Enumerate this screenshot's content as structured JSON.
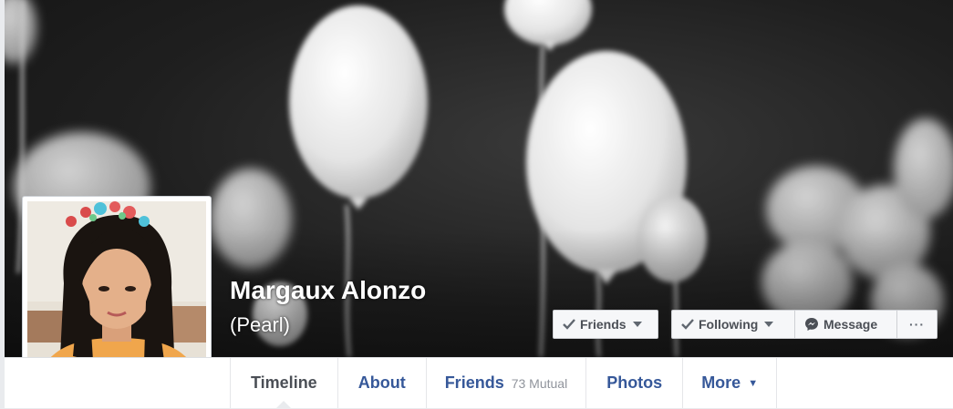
{
  "profile": {
    "name": "Margaux Alonzo",
    "alternate_name": "(Pearl)"
  },
  "actions": {
    "friends_label": "Friends",
    "following_label": "Following",
    "message_label": "Message",
    "more_label": "···"
  },
  "tabs": [
    {
      "label": "Timeline",
      "active": true
    },
    {
      "label": "About"
    },
    {
      "label": "Friends",
      "count": "73 Mutual"
    },
    {
      "label": "Photos"
    },
    {
      "label": "More",
      "caret": "▼"
    }
  ],
  "colors": {
    "link": "#365899",
    "active_tab": "#4b4f56",
    "page_background": "#e9ebee"
  },
  "icons": [
    "check-icon",
    "caret-down-icon",
    "messenger-icon",
    "ellipsis-icon"
  ]
}
